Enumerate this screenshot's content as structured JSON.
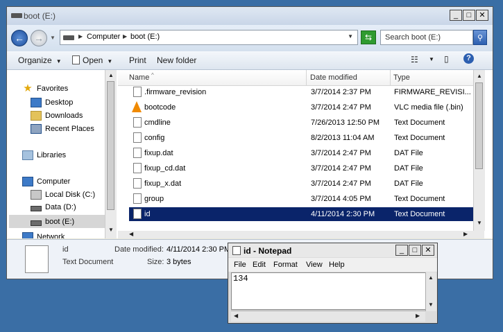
{
  "explorer": {
    "title": "boot (E:)",
    "breadcrumb": [
      "Computer",
      "boot (E:)"
    ],
    "search_placeholder": "Search boot (E:)",
    "toolbar": {
      "organize": "Organize",
      "open": "Open",
      "print": "Print",
      "new_folder": "New folder"
    },
    "columns": {
      "name": "Name",
      "date": "Date modified",
      "type": "Type"
    },
    "nav": {
      "favorites": "Favorites",
      "desktop": "Desktop",
      "downloads": "Downloads",
      "recent": "Recent Places",
      "libraries": "Libraries",
      "computer": "Computer",
      "local_disk": "Local Disk (C:)",
      "data": "Data (D:)",
      "boot": "boot (E:)",
      "network": "Network"
    },
    "files": [
      {
        "name": ".firmware_revision",
        "date": "3/7/2014 2:37 PM",
        "type": "FIRMWARE_REVISI..."
      },
      {
        "name": "bootcode",
        "date": "3/7/2014 2:47 PM",
        "type": "VLC media file (.bin)"
      },
      {
        "name": "cmdline",
        "date": "7/26/2013 12:50 PM",
        "type": "Text Document"
      },
      {
        "name": "config",
        "date": "8/2/2013 11:04 AM",
        "type": "Text Document"
      },
      {
        "name": "fixup.dat",
        "date": "3/7/2014 2:47 PM",
        "type": "DAT File"
      },
      {
        "name": "fixup_cd.dat",
        "date": "3/7/2014 2:47 PM",
        "type": "DAT File"
      },
      {
        "name": "fixup_x.dat",
        "date": "3/7/2014 2:47 PM",
        "type": "DAT File"
      },
      {
        "name": "group",
        "date": "3/7/2014 4:05 PM",
        "type": "Text Document"
      },
      {
        "name": "id",
        "date": "4/11/2014 2:30 PM",
        "type": "Text Document",
        "selected": true
      }
    ],
    "details": {
      "name": "id",
      "type": "Text Document",
      "date_label": "Date modified:",
      "date_value": "4/11/2014 2:30 PM",
      "size_label": "Size:",
      "size_value": "3 bytes"
    }
  },
  "notepad": {
    "title": "id - Notepad",
    "menu": [
      "File",
      "Edit",
      "Format",
      "View",
      "Help"
    ],
    "content": "134"
  },
  "colors": {
    "selection": "#0a246a",
    "desktop": "#3a6ea5"
  }
}
